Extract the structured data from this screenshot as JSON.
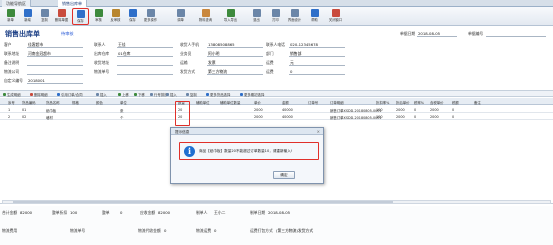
{
  "tabs": [
    "功能导航区",
    "销售出库单"
  ],
  "toolbar": [
    {
      "label": "新单",
      "color": "#3d8a3d"
    },
    {
      "label": "新增",
      "color": "#2f6fc9"
    },
    {
      "label": "复制",
      "color": "#6b86a8"
    },
    {
      "label": "删除单据",
      "color": "#c94b3d"
    },
    {
      "label": "保存",
      "color": "#2f6fc9"
    },
    {
      "label": "审核",
      "color": "#3d8a3d"
    },
    {
      "label": "反审核",
      "color": "#b8862f"
    },
    {
      "label": "保存",
      "color": "#2f6fc9"
    },
    {
      "label": "更多操作",
      "color": "#6b86a8"
    },
    {
      "label": "调单",
      "color": "#6b86a8"
    },
    {
      "label": "物料查询",
      "color": "#c9873d"
    },
    {
      "label": "导入导出",
      "color": "#3d8a3d"
    },
    {
      "label": "退出",
      "color": "#6b86a8"
    },
    {
      "label": "打印",
      "color": "#6b86a8"
    },
    {
      "label": "界面设计",
      "color": "#6b86a8"
    },
    {
      "label": "帮助",
      "color": "#2f6fc9"
    },
    {
      "label": "关闭窗口",
      "color": "#c94b3d"
    }
  ],
  "doc": {
    "title": "销售出库单",
    "status": "待审核",
    "date_label": "单据日期",
    "date_value": "2018-08-05",
    "number_label": "单据编号"
  },
  "form": {
    "row1": [
      {
        "label": "客户",
        "value": "佳客超市"
      },
      {
        "label": "联系人",
        "value": "王佳"
      },
      {
        "label": "收货人手机",
        "value": "13808508865"
      },
      {
        "label": "联系人电话",
        "value": "020-12345678"
      }
    ],
    "row2": [
      {
        "label": "联系地址",
        "value": "河南金冠超市"
      },
      {
        "label": "出库仓库",
        "value": "01仓库"
      },
      {
        "label": "业务员",
        "value": "阿小明"
      },
      {
        "label": "部门",
        "value": "销售部"
      }
    ],
    "row3": [
      {
        "label": "备注说明",
        "value": ""
      },
      {
        "label": "收货地址",
        "value": ""
      },
      {
        "label": "运输",
        "value": "发票"
      },
      {
        "label": "运费",
        "value": "元"
      }
    ],
    "row4": [
      {
        "label": "物流公司",
        "value": ""
      },
      {
        "label": "物流单号",
        "value": ""
      },
      {
        "label": "发货方式",
        "value": "第三方物流"
      },
      {
        "label": "运费",
        "value": "0"
      }
    ],
    "row5": [
      {
        "label": "自定义编号",
        "value": "2018001"
      }
    ]
  },
  "subbar": [
    "生成明细",
    "删除明细",
    "引用订单/合同",
    "插入",
    "上移",
    "下移",
    "行号排序",
    "插入",
    "复制",
    "更多货品选择",
    "更多期初选择"
  ],
  "grid": {
    "headers": [
      "序号",
      "货品编码",
      "货品名称",
      "规格",
      "颜色",
      "单位",
      "数量",
      "辅助单位",
      "辅助单位数量",
      "单价",
      "金额",
      "订单号",
      "订单明细",
      "折扣率%",
      "折后单价",
      "税率%",
      "含税单价",
      "税额",
      "备注"
    ],
    "rows": [
      [
        "1",
        "01",
        "纸巾板",
        "",
        "",
        "张",
        "20",
        "",
        "",
        "2000",
        "40000",
        "",
        "销售订单XSDD-20180805-0001",
        "100",
        "2000",
        "0",
        "2000",
        "0",
        ""
      ],
      [
        "2",
        "02",
        "墙材",
        "",
        "",
        "个",
        "20",
        "",
        "",
        "2000",
        "40000",
        "",
        "销售订单XSDD-20180805-0001",
        "100",
        "2000",
        "0",
        "2000",
        "0",
        ""
      ]
    ],
    "total_qty": "40",
    "total_amount": "80000"
  },
  "totals": {
    "row1": [
      {
        "label": "合计金额",
        "value": "82000"
      },
      {
        "label": "整单折扣",
        "value": "100"
      },
      {
        "label": "整单",
        "value": "0"
      },
      {
        "label": "应收金额",
        "value": "82000"
      },
      {
        "label": "制单人",
        "value": "王小二"
      },
      {
        "label": "制单日期",
        "value": "2018-08-05"
      }
    ],
    "row2": [
      {
        "label": "物流费用",
        "value": ""
      },
      {
        "label": "物流单号",
        "value": ""
      },
      {
        "label": "物流代收金额",
        "value": "0"
      },
      {
        "label": "物流运费",
        "value": "0"
      },
      {
        "label": "运费打包方式",
        "value": "(第三方物流)发货方式"
      }
    ]
  },
  "dialog": {
    "title": "提示信息",
    "message": "商品【纸巾板】数量20不能超过订单数量10，请重新输入!",
    "ok_label": "确定"
  }
}
